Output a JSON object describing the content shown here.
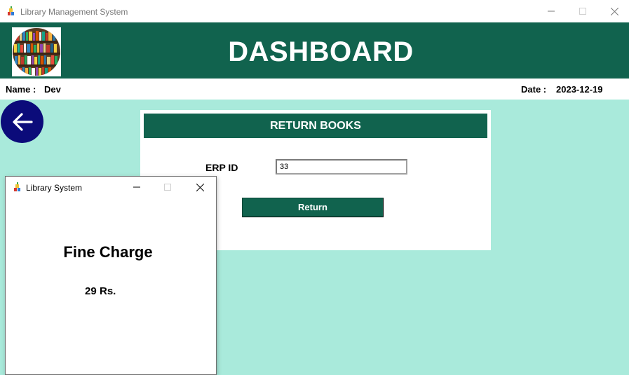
{
  "window": {
    "title": "Library Management System",
    "icon": "app-icon"
  },
  "header": {
    "title": "DASHBOARD",
    "logo": "bookshelf-logo",
    "background": "#11634e"
  },
  "info": {
    "name_label": "Name :",
    "name_value": "Dev",
    "date_label": "Date :",
    "date_value": "2023-12-19"
  },
  "content": {
    "background": "#a9eadb",
    "back_icon": "arrow-left-icon"
  },
  "return_panel": {
    "heading": "RETURN BOOKS",
    "erp_label": "ERP ID",
    "erp_value": "33",
    "return_button": "Return"
  },
  "popup": {
    "title": "Library System",
    "heading": "Fine Charge",
    "amount": "29",
    "unit": "Rs."
  }
}
